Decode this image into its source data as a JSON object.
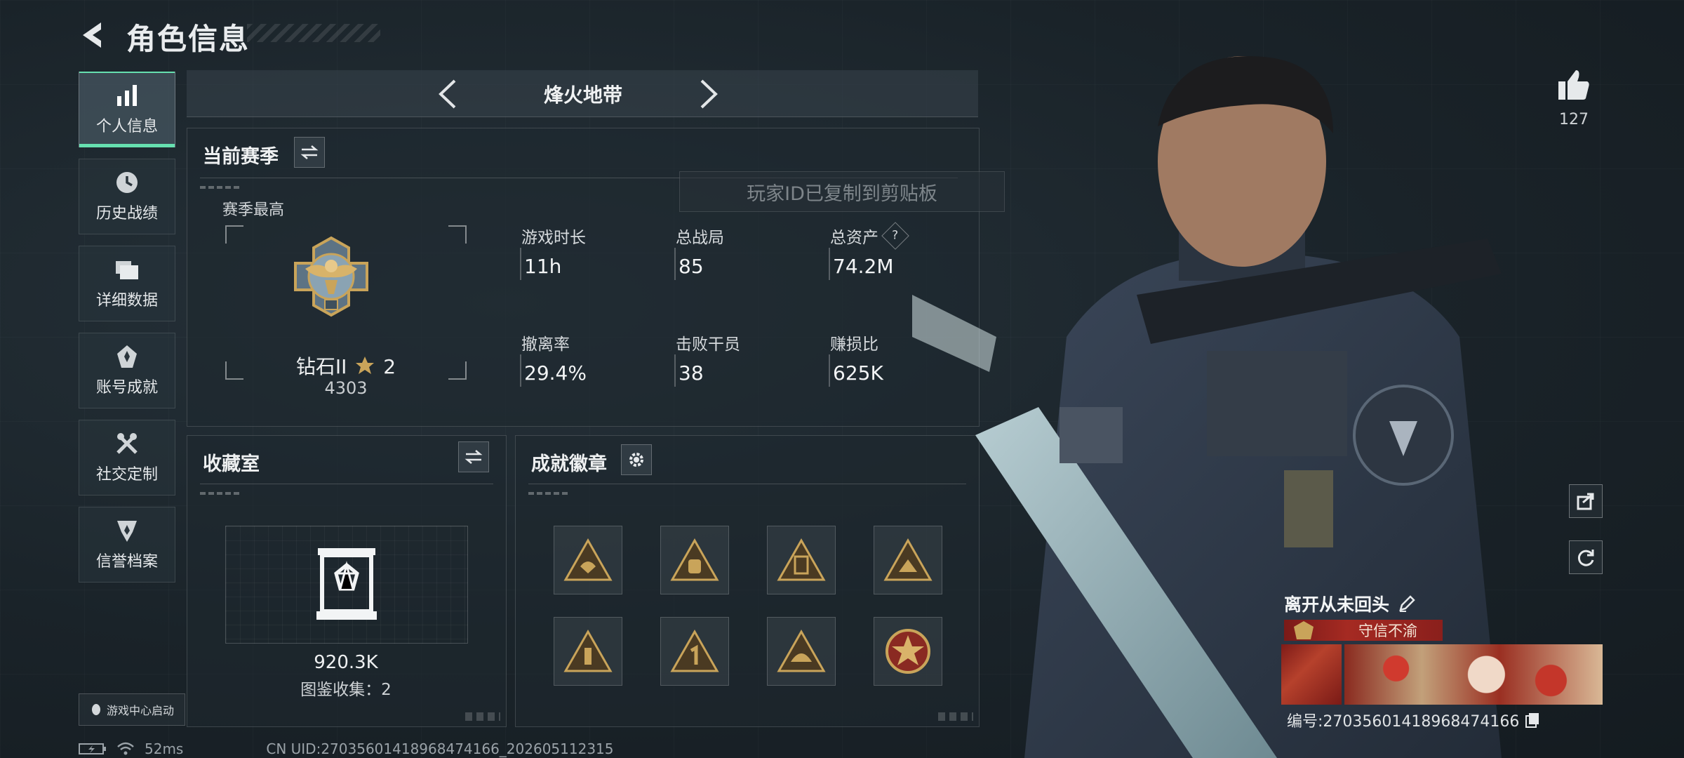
{
  "header": {
    "title": "角色信息"
  },
  "sidebar": {
    "items": [
      {
        "label": "个人信息",
        "icon": "bar-chart-icon",
        "active": true
      },
      {
        "label": "历史战绩",
        "icon": "history-clock-icon"
      },
      {
        "label": "详细数据",
        "icon": "folder-icon"
      },
      {
        "label": "账号成就",
        "icon": "achievement-icon"
      },
      {
        "label": "社交定制",
        "icon": "tools-icon"
      },
      {
        "label": "信誉档案",
        "icon": "reputation-icon"
      }
    ]
  },
  "mode": {
    "name": "烽火地带"
  },
  "season": {
    "title": "当前赛季",
    "best_label": "赛季最高",
    "rank": "钻石II",
    "stars": "2",
    "score": "4303",
    "stats": [
      {
        "label": "游戏时长",
        "value": "11h"
      },
      {
        "label": "总战局",
        "value": "85"
      },
      {
        "label": "总资产",
        "value": "74.2M",
        "help": "?"
      },
      {
        "label": "撤离率",
        "value": "29.4%"
      },
      {
        "label": "击败干员",
        "value": "38"
      },
      {
        "label": "赚损比",
        "value": "625K"
      }
    ]
  },
  "toast": {
    "text": "玩家ID已复制到剪贴板"
  },
  "collection": {
    "title": "收藏室",
    "value": "920.3K",
    "count_text": "图鉴收集：2"
  },
  "badges": {
    "title": "成就徽章",
    "count": 8
  },
  "profile": {
    "likes": "127",
    "name": "离开从未回头",
    "title": "守信不渝",
    "uid_text": "编号:27035601418968474166"
  },
  "bottom": {
    "launch_label": "游戏中心启动",
    "ping": "52ms",
    "uid_line": "CN UID:27035601418968474166_202605112315"
  },
  "colors": {
    "accent": "#66e0b0",
    "title_red": "#a52a22",
    "gold": "#c9a45a"
  }
}
